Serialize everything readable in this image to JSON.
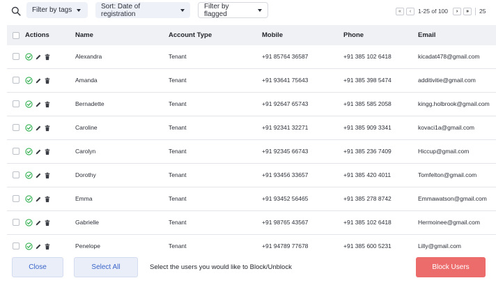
{
  "toolbar": {
    "filter_tags": "Filter by tags",
    "sort": "Sort: Date of registration",
    "filter_flagged": "Filter by flagged"
  },
  "pagination": {
    "first": "«",
    "prev": "‹",
    "range": "1-25 of 100",
    "next": "›",
    "last": "»",
    "per_page": "25"
  },
  "table": {
    "headers": {
      "actions": "Actions",
      "name": "Name",
      "account_type": "Account Type",
      "mobile": "Mobile",
      "phone": "Phone",
      "email": "Email"
    },
    "rows": [
      {
        "name": "Alexandra",
        "account_type": "Tenant",
        "mobile": "+91 85764 36587",
        "phone": "+91 385 102 6418",
        "email": "kicadat478@gmail.com"
      },
      {
        "name": "Amanda",
        "account_type": "Tenant",
        "mobile": "+91 93641 75643",
        "phone": "+91 385 398 5474",
        "email": "additivitie@gmail.com"
      },
      {
        "name": "Bernadette",
        "account_type": "Tenant",
        "mobile": "+91 92647 65743",
        "phone": "+91 385 585 2058",
        "email": "kingg.holbrook@gmail.com"
      },
      {
        "name": "Caroline",
        "account_type": "Tenant",
        "mobile": "+91 92341 32271",
        "phone": "+91 385 909 3341",
        "email": "kovaci1a@gmail.com"
      },
      {
        "name": "Carolyn",
        "account_type": "Tenant",
        "mobile": "+91 92345 66743",
        "phone": "+91 385 236 7409",
        "email": "Hiccup@gmail.com"
      },
      {
        "name": "Dorothy",
        "account_type": "Tenant",
        "mobile": "+91 93456 33657",
        "phone": "+91 385 420 4011",
        "email": "Tomfelton@gmail.com"
      },
      {
        "name": "Emma",
        "account_type": "Tenant",
        "mobile": "+91 93452 56465",
        "phone": "+91 385 278 8742",
        "email": "Emmawatson@gmail.com"
      },
      {
        "name": "Gabrielle",
        "account_type": "Tenant",
        "mobile": "+91 98765 43567",
        "phone": "+91 385 102 6418",
        "email": "Hermoinee@gmail.com"
      },
      {
        "name": "Penelope",
        "account_type": "Tenant",
        "mobile": "+91 94789 77678",
        "phone": "+91 385 600 5231",
        "email": "Lilly@gmail.com"
      }
    ]
  },
  "footer": {
    "close": "Close",
    "select_all": "Select All",
    "hint": "Select the users you would like to Block/Unblock",
    "block_users": "Block Users"
  },
  "icons": {
    "approve": "check-circle-icon",
    "edit": "pencil-icon",
    "delete": "trash-icon",
    "search": "search-icon"
  },
  "colors": {
    "approve_green": "#2fae4d",
    "accent_blue": "#3a64c8",
    "block_red": "#ec6b6b",
    "header_bg": "#f0f1f5"
  }
}
